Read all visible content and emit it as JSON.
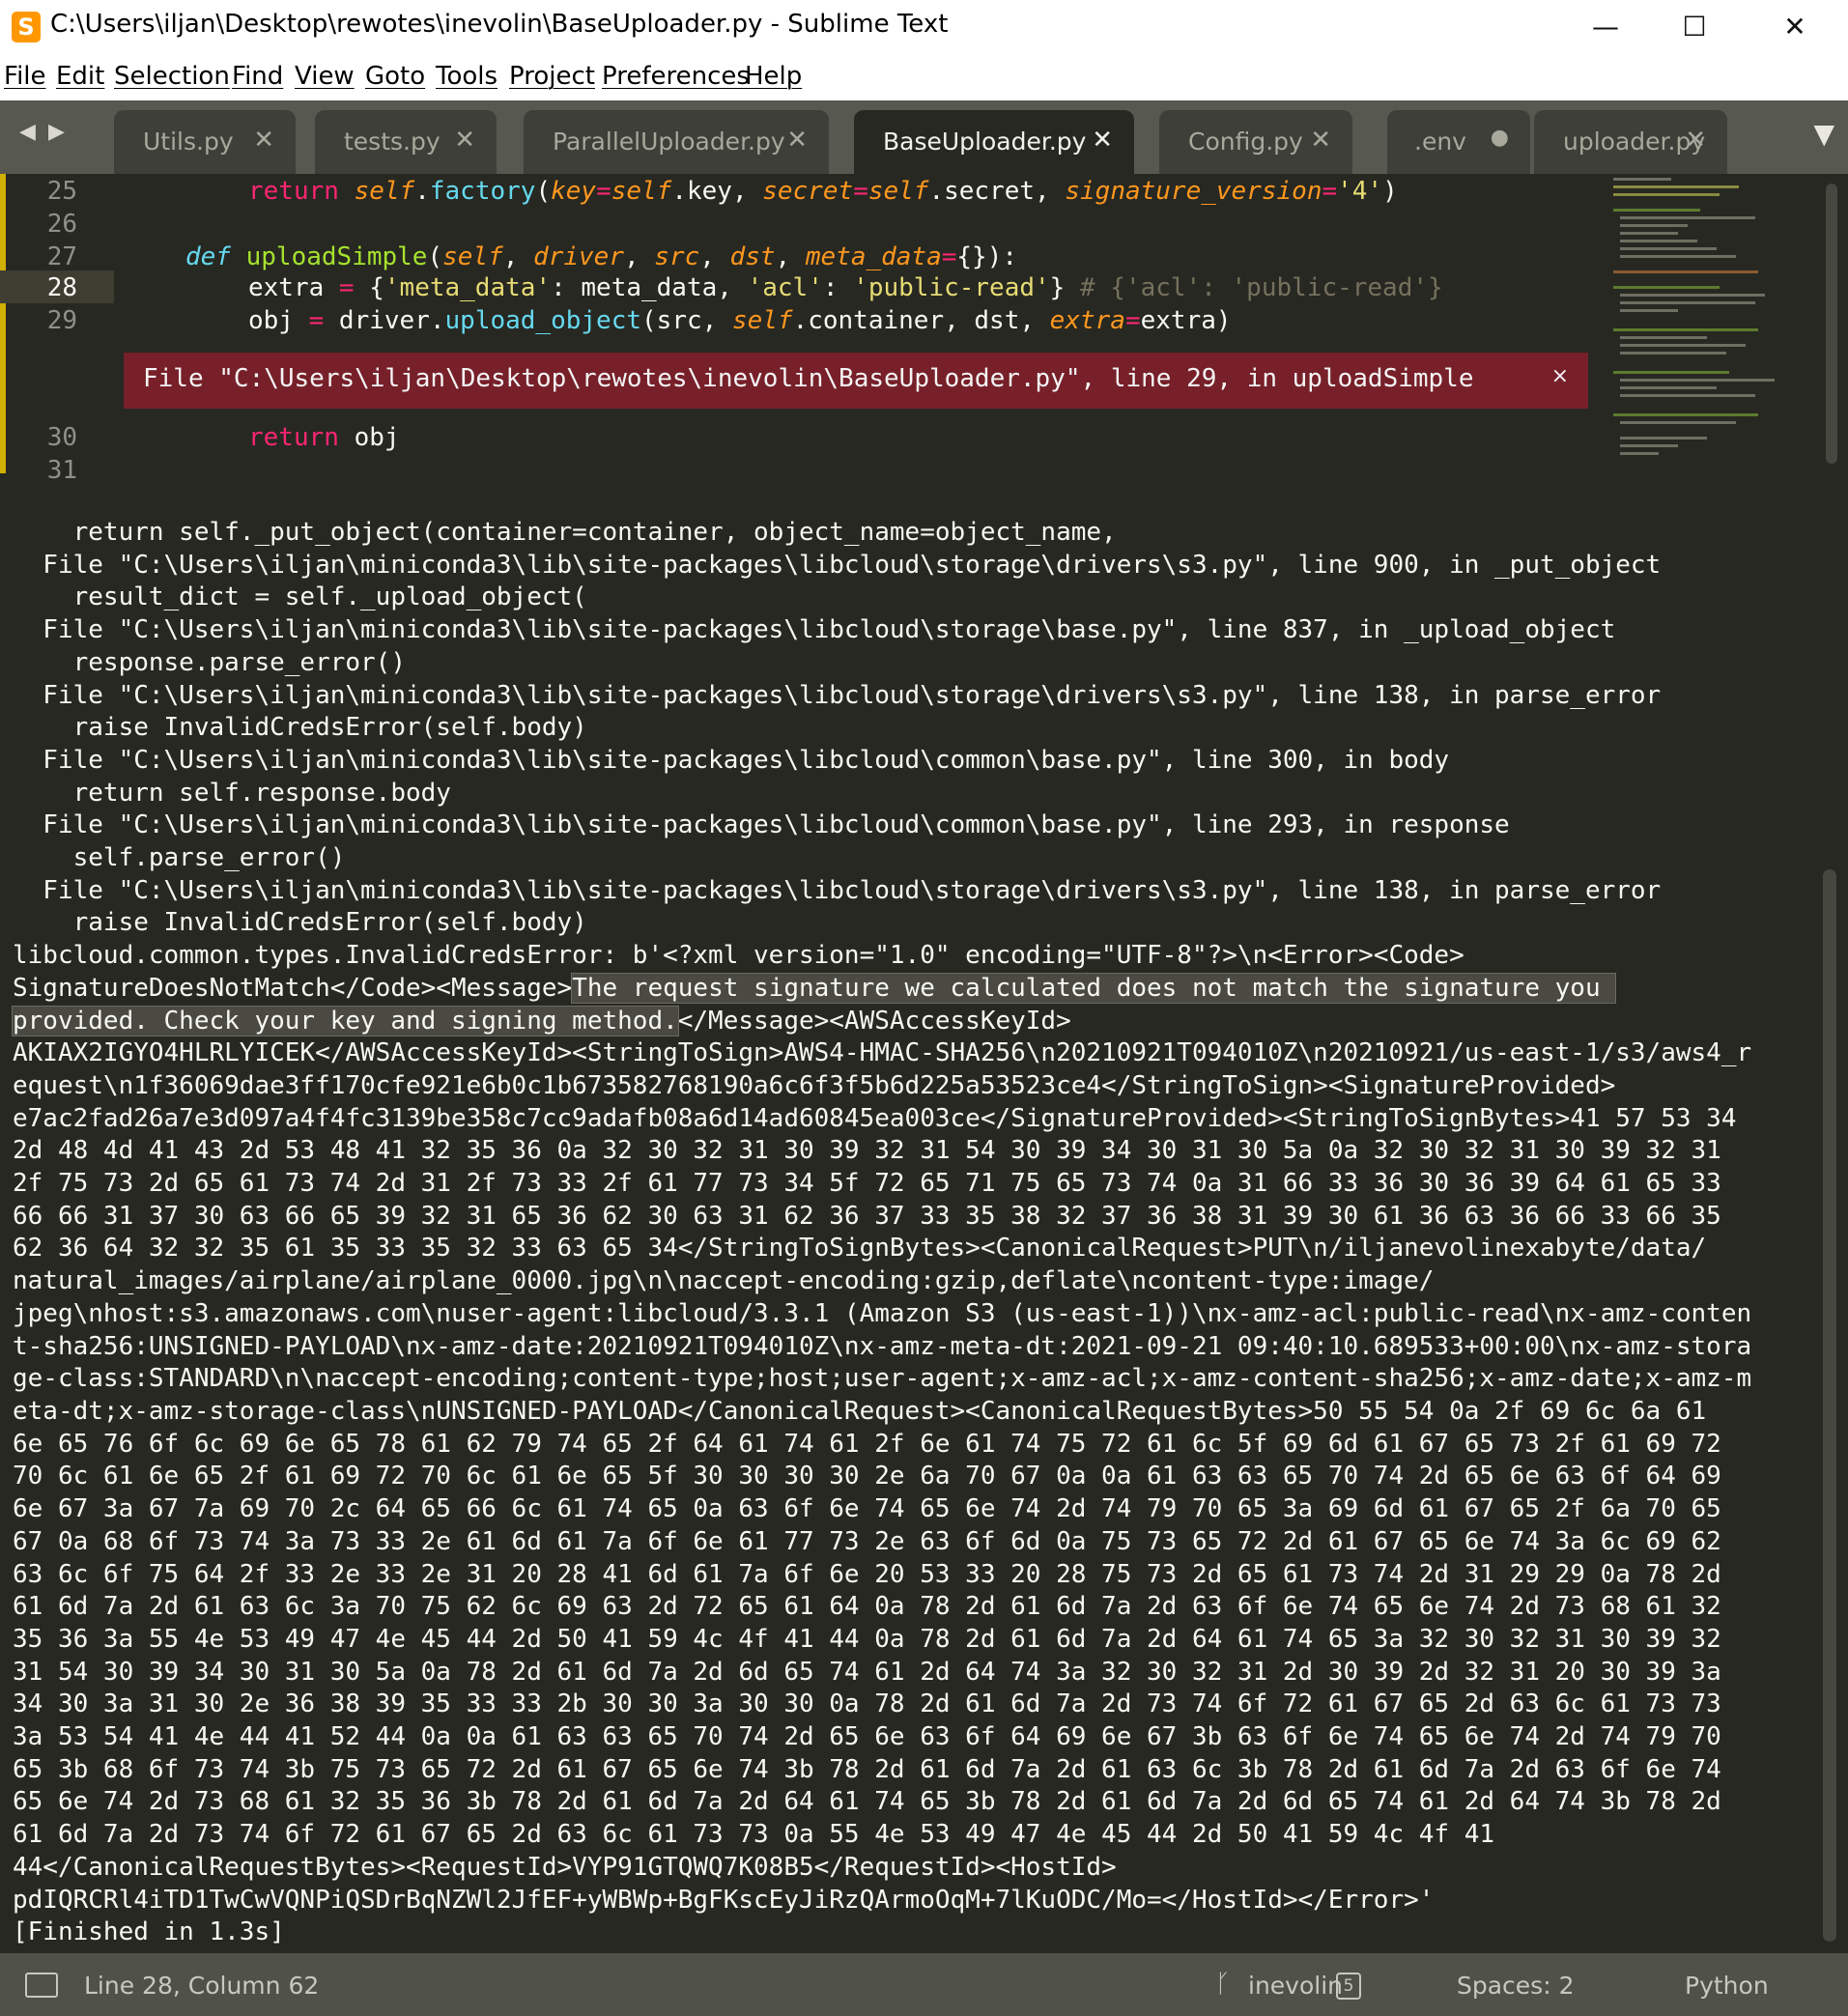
{
  "window": {
    "title": "C:\\Users\\iljan\\Desktop\\rewotes\\inevolin\\BaseUploader.py - Sublime Text",
    "minimize": "—",
    "maximize": "☐",
    "close": "✕"
  },
  "menu": [
    "File",
    "Edit",
    "Selection",
    "Find",
    "View",
    "Goto",
    "Tools",
    "Project",
    "Preferences",
    "Help"
  ],
  "tabs": [
    {
      "label": "Utils.py",
      "state": "close"
    },
    {
      "label": "tests.py",
      "state": "close"
    },
    {
      "label": "ParallelUploader.py",
      "state": "close"
    },
    {
      "label": "BaseUploader.py",
      "state": "active"
    },
    {
      "label": "Config.py",
      "state": "close"
    },
    {
      "label": ".env",
      "state": "dirty"
    },
    {
      "label": "uploader.py",
      "state": "close"
    }
  ],
  "editor": {
    "line_numbers": [
      "25",
      "26",
      "27",
      "28",
      "29",
      "30",
      "31"
    ],
    "error_banner": "File \"C:\\Users\\iljan\\Desktop\\rewotes\\inevolin\\BaseUploader.py\", line 29, in uploadSimple",
    "error_close": "×"
  },
  "output": {
    "before_selection": "    return self._put_object(container=container, object_name=object_name,\n  File \"C:\\Users\\iljan\\miniconda3\\lib\\site-packages\\libcloud\\storage\\drivers\\s3.py\", line 900, in _put_object\n    result_dict = self._upload_object(\n  File \"C:\\Users\\iljan\\miniconda3\\lib\\site-packages\\libcloud\\storage\\base.py\", line 837, in _upload_object\n    response.parse_error()\n  File \"C:\\Users\\iljan\\miniconda3\\lib\\site-packages\\libcloud\\storage\\drivers\\s3.py\", line 138, in parse_error\n    raise InvalidCredsError(self.body)\n  File \"C:\\Users\\iljan\\miniconda3\\lib\\site-packages\\libcloud\\common\\base.py\", line 300, in body\n    return self.response.body\n  File \"C:\\Users\\iljan\\miniconda3\\lib\\site-packages\\libcloud\\common\\base.py\", line 293, in response\n    self.parse_error()\n  File \"C:\\Users\\iljan\\miniconda3\\lib\\site-packages\\libcloud\\storage\\drivers\\s3.py\", line 138, in parse_error\n    raise InvalidCredsError(self.body)\nlibcloud.common.types.InvalidCredsError: b'<?xml version=\"1.0\" encoding=\"UTF-8\"?>\\n<Error><Code>\nSignatureDoesNotMatch</Code><Message>",
    "selection_line1": "The request signature we calculated does not match the signature you ",
    "selection_line2": "provided. Check your key and signing method.",
    "after_selection": "</Message><AWSAccessKeyId>\nAKIAX2IGYO4HLRLYICEK</AWSAccessKeyId><StringToSign>AWS4-HMAC-SHA256\\n20210921T094010Z\\n20210921/us-east-1/s3/aws4_r\nequest\\n1f36069dae3ff170cfe921e6b0c1b673582768190a6c6f3f5b6d225a53523ce4</StringToSign><SignatureProvided>\ne7ac2fad26a7e3d097a4f4fc3139be358c7cc9adafb08a6d14ad60845ea003ce</SignatureProvided><StringToSignBytes>41 57 53 34\n2d 48 4d 41 43 2d 53 48 41 32 35 36 0a 32 30 32 31 30 39 32 31 54 30 39 34 30 31 30 5a 0a 32 30 32 31 30 39 32 31\n2f 75 73 2d 65 61 73 74 2d 31 2f 73 33 2f 61 77 73 34 5f 72 65 71 75 65 73 74 0a 31 66 33 36 30 36 39 64 61 65 33\n66 66 31 37 30 63 66 65 39 32 31 65 36 62 30 63 31 62 36 37 33 35 38 32 37 36 38 31 39 30 61 36 63 36 66 33 66 35\n62 36 64 32 32 35 61 35 33 35 32 33 63 65 34</StringToSignBytes><CanonicalRequest>PUT\\n/iljanevolinexabyte/data/\nnatural_images/airplane/airplane_0000.jpg\\n\\naccept-encoding:gzip,deflate\\ncontent-type:image/\njpeg\\nhost:s3.amazonaws.com\\nuser-agent:libcloud/3.3.1 (Amazon S3 (us-east-1))\\nx-amz-acl:public-read\\nx-amz-conten\nt-sha256:UNSIGNED-PAYLOAD\\nx-amz-date:20210921T094010Z\\nx-amz-meta-dt:2021-09-21 09:40:10.689533+00:00\\nx-amz-stora\nge-class:STANDARD\\n\\naccept-encoding;content-type;host;user-agent;x-amz-acl;x-amz-content-sha256;x-amz-date;x-amz-m\neta-dt;x-amz-storage-class\\nUNSIGNED-PAYLOAD</CanonicalRequest><CanonicalRequestBytes>50 55 54 0a 2f 69 6c 6a 61\n6e 65 76 6f 6c 69 6e 65 78 61 62 79 74 65 2f 64 61 74 61 2f 6e 61 74 75 72 61 6c 5f 69 6d 61 67 65 73 2f 61 69 72\n70 6c 61 6e 65 2f 61 69 72 70 6c 61 6e 65 5f 30 30 30 30 2e 6a 70 67 0a 0a 61 63 63 65 70 74 2d 65 6e 63 6f 64 69\n6e 67 3a 67 7a 69 70 2c 64 65 66 6c 61 74 65 0a 63 6f 6e 74 65 6e 74 2d 74 79 70 65 3a 69 6d 61 67 65 2f 6a 70 65\n67 0a 68 6f 73 74 3a 73 33 2e 61 6d 61 7a 6f 6e 61 77 73 2e 63 6f 6d 0a 75 73 65 72 2d 61 67 65 6e 74 3a 6c 69 62\n63 6c 6f 75 64 2f 33 2e 33 2e 31 20 28 41 6d 61 7a 6f 6e 20 53 33 20 28 75 73 2d 65 61 73 74 2d 31 29 29 0a 78 2d\n61 6d 7a 2d 61 63 6c 3a 70 75 62 6c 69 63 2d 72 65 61 64 0a 78 2d 61 6d 7a 2d 63 6f 6e 74 65 6e 74 2d 73 68 61 32\n35 36 3a 55 4e 53 49 47 4e 45 44 2d 50 41 59 4c 4f 41 44 0a 78 2d 61 6d 7a 2d 64 61 74 65 3a 32 30 32 31 30 39 32\n31 54 30 39 34 30 31 30 5a 0a 78 2d 61 6d 7a 2d 6d 65 74 61 2d 64 74 3a 32 30 32 31 2d 30 39 2d 32 31 20 30 39 3a\n34 30 3a 31 30 2e 36 38 39 35 33 33 2b 30 30 3a 30 30 0a 78 2d 61 6d 7a 2d 73 74 6f 72 61 67 65 2d 63 6c 61 73 73\n3a 53 54 41 4e 44 41 52 44 0a 0a 61 63 63 65 70 74 2d 65 6e 63 6f 64 69 6e 67 3b 63 6f 6e 74 65 6e 74 2d 74 79 70\n65 3b 68 6f 73 74 3b 75 73 65 72 2d 61 67 65 6e 74 3b 78 2d 61 6d 7a 2d 61 63 6c 3b 78 2d 61 6d 7a 2d 63 6f 6e 74\n65 6e 74 2d 73 68 61 32 35 36 3b 78 2d 61 6d 7a 2d 64 61 74 65 3b 78 2d 61 6d 7a 2d 6d 65 74 61 2d 64 74 3b 78 2d\n61 6d 7a 2d 73 74 6f 72 61 67 65 2d 63 6c 61 73 73 0a 55 4e 53 49 47 4e 45 44 2d 50 41 59 4c 4f 41\n44</CanonicalRequestBytes><RequestId>VYP91GTQWQ7K08B5</RequestId><HostId>\npdIQRCRl4iTD1TwCwVQNPiQSDrBqNZWl2JfEF+yWBWp+BgFKscEyJiRzQArmoOqM+7lKuODC/Mo=</HostId></Error>'\n[Finished in 1.3s]"
  },
  "status": {
    "position": "Line 28, Column 62",
    "branch": "inevolin",
    "branch_badge": "5",
    "spaces": "Spaces: 2",
    "syntax": "Python"
  }
}
